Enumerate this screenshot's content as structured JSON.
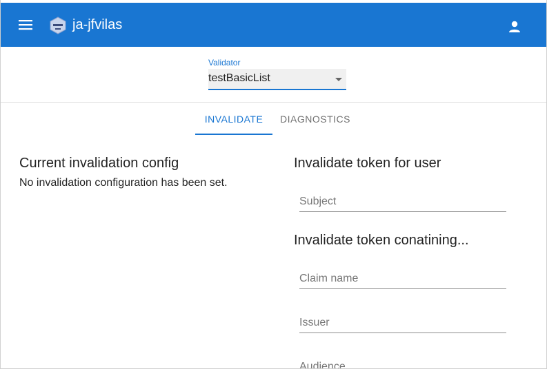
{
  "appbar": {
    "title": "ja-jfvilas",
    "accent": "#1976d2",
    "menu_icon": "hamburger-menu-icon",
    "logo_icon": "app-logo-icon",
    "user_icon": "account-icon"
  },
  "validator": {
    "label": "Validator",
    "selected": "testBasicList"
  },
  "tabs": [
    {
      "label": "INVALIDATE",
      "active": true
    },
    {
      "label": "DIAGNOSTICS",
      "active": false
    }
  ],
  "current_config": {
    "title": "Current invalidation config",
    "message": "No invalidation configuration has been set."
  },
  "invalidate_user": {
    "title": "Invalidate token for user",
    "subject_placeholder": "Subject"
  },
  "invalidate_containing": {
    "title": "Invalidate token conatining...",
    "claim_placeholder": "Claim name",
    "issuer_placeholder": "Issuer",
    "audience_placeholder": "Audience"
  }
}
